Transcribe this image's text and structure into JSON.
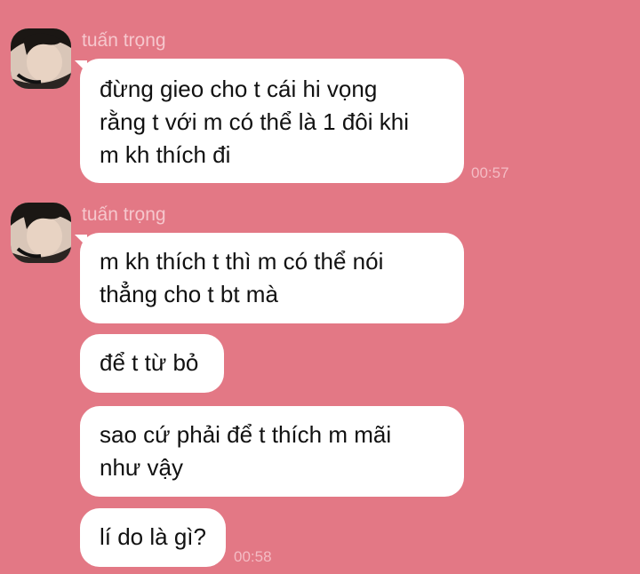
{
  "colors": {
    "background": "#e37885",
    "bubble": "#ffffff",
    "sender": "#f6c7cd",
    "time": "#f4bcc4"
  },
  "messages": [
    {
      "sender": "tuấn trọng",
      "avatar": "user-avatar",
      "bubbles": [
        {
          "lines": [
            "đừng gieo cho t cái hi vọng",
            "rằng t với m có thể là 1 đôi khi",
            "m kh thích đi"
          ]
        }
      ],
      "time": "00:57"
    },
    {
      "sender": "tuấn trọng",
      "avatar": "user-avatar",
      "bubbles": [
        {
          "lines": [
            "m kh thích t thì m có thể nói",
            "thẳng cho t bt mà"
          ]
        },
        {
          "lines": [
            "để t từ bỏ"
          ]
        },
        {
          "lines": [
            "sao cứ phải để t thích m mãi",
            "như vậy"
          ]
        },
        {
          "lines": [
            "lí do là gì?"
          ]
        }
      ],
      "time": "00:58"
    }
  ]
}
